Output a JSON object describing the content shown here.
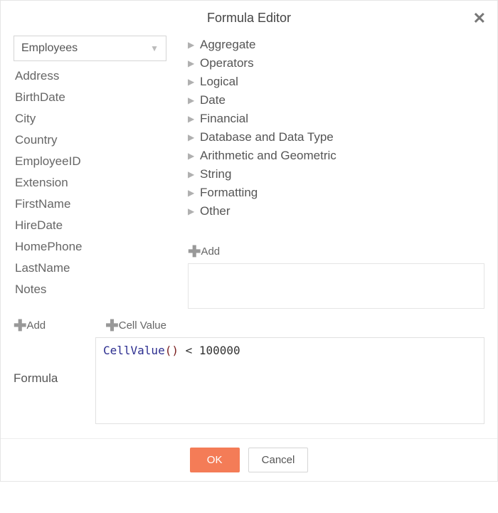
{
  "title": "Formula Editor",
  "table_select": {
    "value": "Employees"
  },
  "fields": [
    "Address",
    "BirthDate",
    "City",
    "Country",
    "EmployeeID",
    "Extension",
    "FirstName",
    "HireDate",
    "HomePhone",
    "LastName",
    "Notes"
  ],
  "left_buttons": {
    "add": "Add",
    "cell_value": "Cell Value"
  },
  "categories": [
    "Aggregate",
    "Operators",
    "Logical",
    "Date",
    "Financial",
    "Database and Data Type",
    "Arithmetic and Geometric",
    "String",
    "Formatting",
    "Other"
  ],
  "right_add": "Add",
  "formula_label": "Formula",
  "formula_tokens": {
    "fn": "CellValue",
    "open": "(",
    "close": ")",
    "rest": " < 100000"
  },
  "buttons": {
    "ok": "OK",
    "cancel": "Cancel"
  }
}
